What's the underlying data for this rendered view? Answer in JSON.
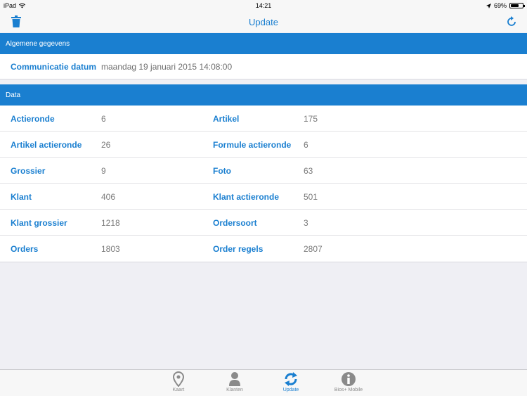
{
  "status": {
    "device": "iPad",
    "time": "14:21",
    "battery": "69%",
    "battery_level": 0.69
  },
  "nav": {
    "title": "Update"
  },
  "general": {
    "header": "Algemene gegevens",
    "label": "Communicatie datum",
    "value": "maandag 19 januari 2015 14:08:00"
  },
  "data": {
    "header": "Data",
    "rows": [
      {
        "l1": "Actieronde",
        "v1": "6",
        "l2": "Artikel",
        "v2": "175"
      },
      {
        "l1": "Artikel actieronde",
        "v1": "26",
        "l2": "Formule actieronde",
        "v2": "6"
      },
      {
        "l1": "Grossier",
        "v1": "9",
        "l2": "Foto",
        "v2": "63"
      },
      {
        "l1": "Klant",
        "v1": "406",
        "l2": "Klant actieronde",
        "v2": "501"
      },
      {
        "l1": "Klant grossier",
        "v1": "1218",
        "l2": "Ordersoort",
        "v2": "3"
      },
      {
        "l1": "Orders",
        "v1": "1803",
        "l2": "Order regels",
        "v2": "2807"
      }
    ]
  },
  "tabs": [
    {
      "label": "Kaart",
      "icon": "map-pin-icon"
    },
    {
      "label": "Klanten",
      "icon": "person-icon"
    },
    {
      "label": "Update",
      "icon": "refresh-icon"
    },
    {
      "label": "Bios+ Mobile",
      "icon": "info-icon"
    }
  ],
  "colors": {
    "accent": "#1a7fd0"
  }
}
